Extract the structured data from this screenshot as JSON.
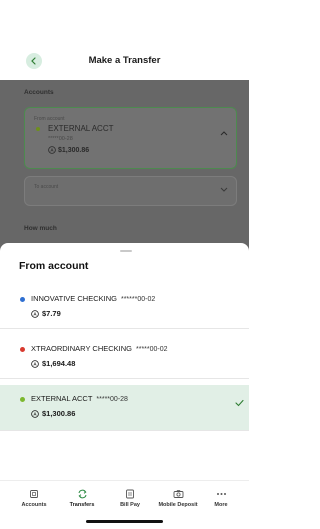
{
  "header": {
    "title": "Make a Transfer"
  },
  "background": {
    "accounts_label": "Accounts",
    "from_card": {
      "label": "From account",
      "name": "EXTERNAL ACCT",
      "mask": "*****00-28",
      "balance": "$1,300.86"
    },
    "to_card": {
      "label": "To account"
    },
    "how_much_label": "How much"
  },
  "sheet": {
    "title": "From account",
    "accounts": [
      {
        "name": "INNOVATIVE CHECKING",
        "mask": "******00-02",
        "balance": "$7.79",
        "color": "#2f6fd1",
        "selected": false
      },
      {
        "name": "XTRAORDINARY CHECKING",
        "mask": "*****00-02",
        "balance": "$1,694.48",
        "color": "#d83a2f",
        "selected": false
      },
      {
        "name": "EXTERNAL ACCT",
        "mask": "*****00-28",
        "balance": "$1,300.86",
        "color": "#7cb82f",
        "selected": true
      }
    ]
  },
  "tabbar": {
    "items": [
      {
        "label": "Accounts",
        "icon": "accounts-icon"
      },
      {
        "label": "Transfers",
        "icon": "transfers-icon",
        "active": true
      },
      {
        "label": "Bill Pay",
        "icon": "bill-pay-icon"
      },
      {
        "label": "Mobile Deposit",
        "icon": "camera-icon"
      },
      {
        "label": "More",
        "icon": "more-icon"
      }
    ]
  },
  "colors": {
    "accent_green": "#2e8b45",
    "selected_row_bg": "#e1efe6"
  }
}
